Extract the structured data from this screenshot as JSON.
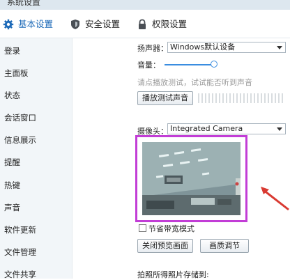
{
  "window": {
    "title": "系统设置"
  },
  "tabs": [
    {
      "label": "基本设置",
      "icon": "gear-icon",
      "active": true
    },
    {
      "label": "安全设置",
      "icon": "shield-icon",
      "active": false
    },
    {
      "label": "权限设置",
      "icon": "lock-icon",
      "active": false
    }
  ],
  "sidebar": {
    "items": [
      {
        "label": "登录"
      },
      {
        "label": "主面板"
      },
      {
        "label": "状态"
      },
      {
        "label": "会话窗口"
      },
      {
        "label": "信息展示"
      },
      {
        "label": "提醒"
      },
      {
        "label": "热键"
      },
      {
        "label": "声音"
      },
      {
        "label": "软件更新"
      },
      {
        "label": "文件管理"
      },
      {
        "label": "文件共享"
      }
    ]
  },
  "audio": {
    "speaker_label": "扬声器：",
    "speaker_value": "Windows默认设备",
    "volume_label": "音量：",
    "volume_level": 0.95,
    "hint": "请点播放测试，试试能否听到声音",
    "play_button": "播放测试声音"
  },
  "camera": {
    "label": "摄像头：",
    "value": "Integrated Camera",
    "bandwidth_label": "节省带宽模式",
    "bandwidth_checked": false,
    "close_preview_button": "关闭预览画面",
    "quality_button": "画质调节",
    "save_label": "拍照所得照片存储到:"
  },
  "colors": {
    "highlight": "#c23dd6",
    "arrow": "#d93a32",
    "accent": "#1d6ab8"
  }
}
